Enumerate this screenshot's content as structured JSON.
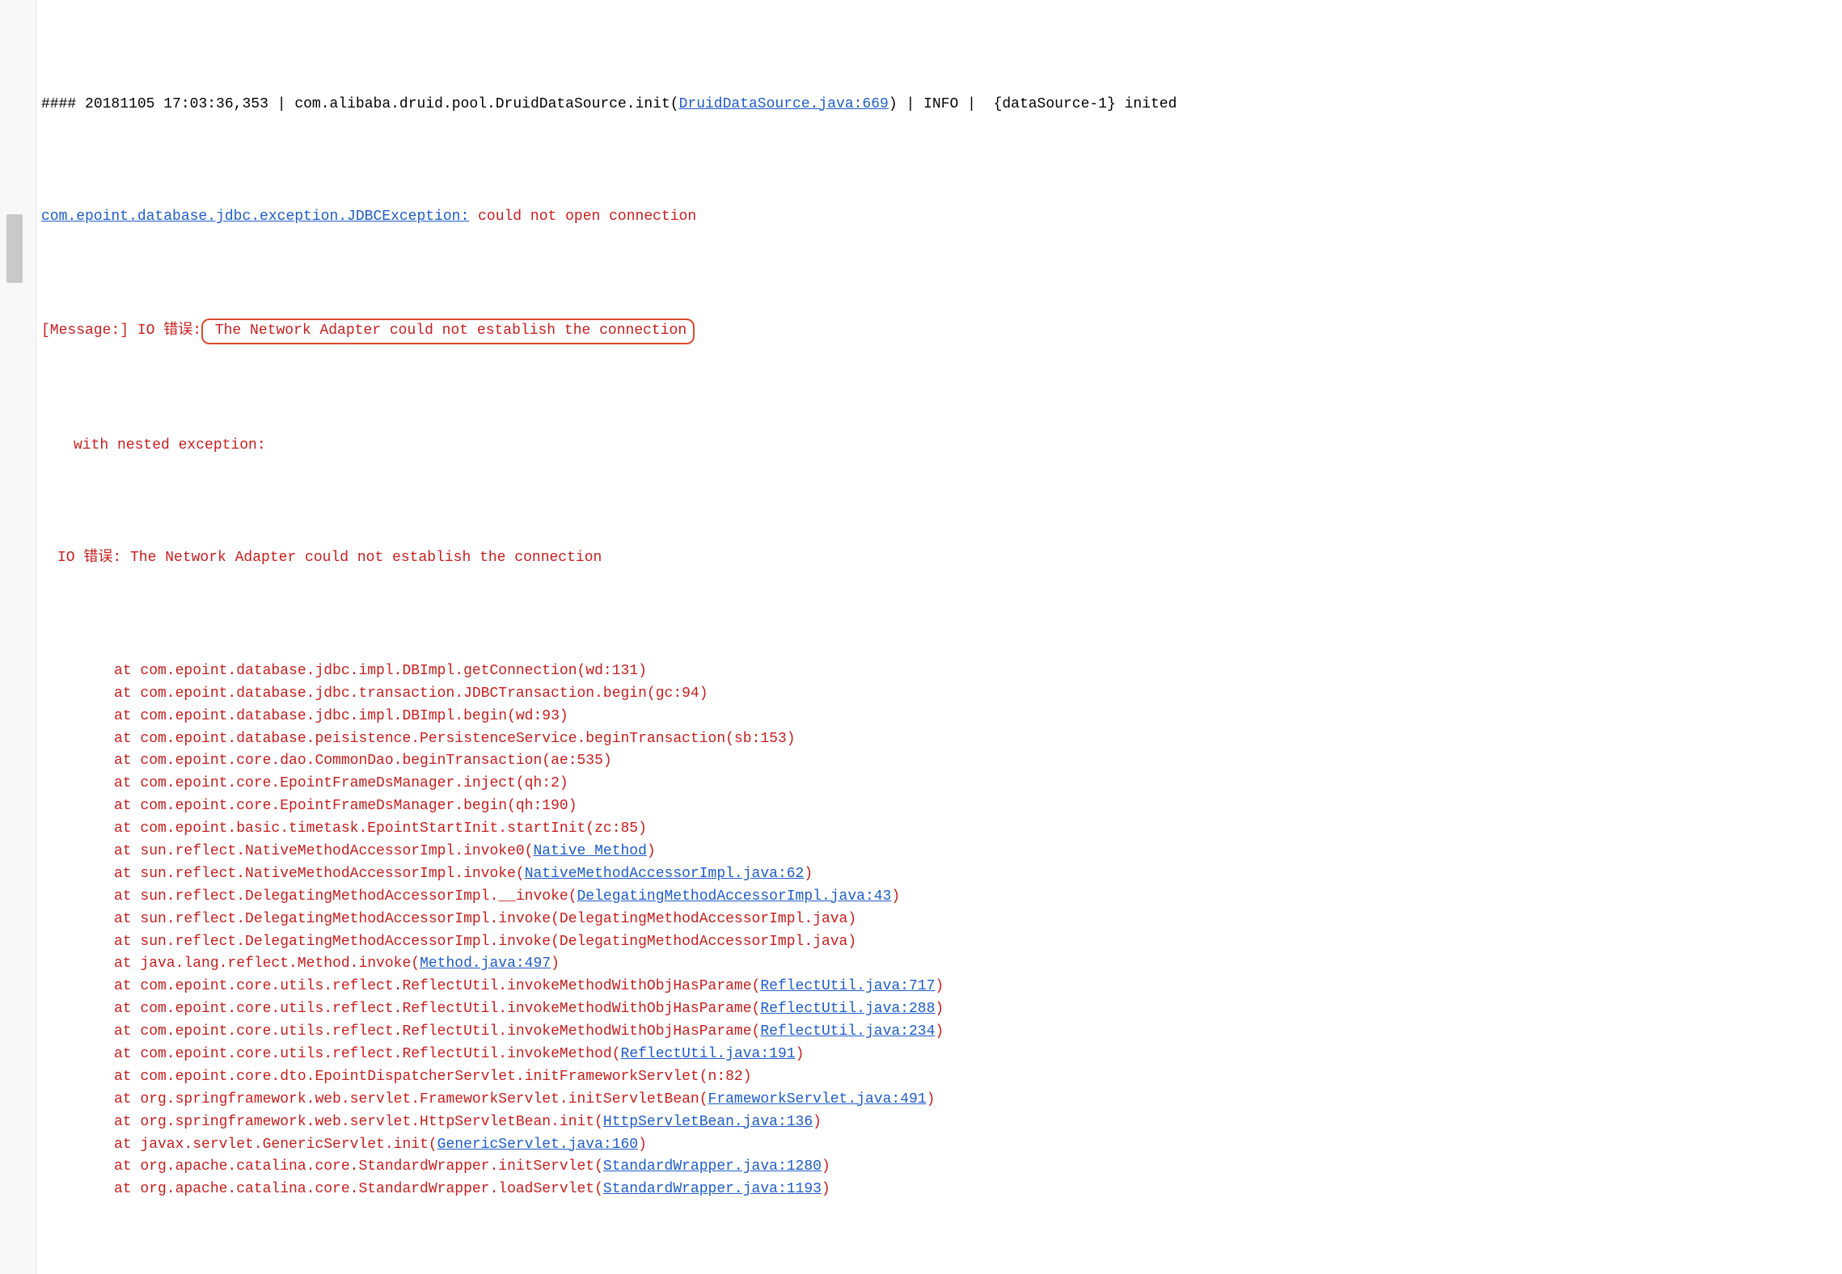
{
  "header": {
    "prefix": "####",
    "timestamp": "20181105 17:03:36,353",
    "sep1": "|",
    "class": "com.alibaba.druid.pool.DruidDataSource.init(",
    "source_link": "DruidDataSource.java:669",
    "close": ")",
    "sep2": "|",
    "level": "INFO",
    "sep3": "|",
    "msg": "{dataSource-1} inited"
  },
  "exc": {
    "class_link": "com.epoint.database.jdbc.exception.JDBCException:",
    "class_msg": " could not open connection",
    "msg_prefix": "[Message:] IO 错误:",
    "highlight": " The Network Adapter could not establish the connection",
    "nested": "with nested exception:",
    "io_line": "IO 错误: The Network Adapter could not establish the connection"
  },
  "stack": [
    {
      "pre": "at com.epoint.database.jdbc.impl.DBImpl.getConnection(wd:131)",
      "link": "",
      "post": ""
    },
    {
      "pre": "at com.epoint.database.jdbc.transaction.JDBCTransaction.begin(gc:94)",
      "link": "",
      "post": ""
    },
    {
      "pre": "at com.epoint.database.jdbc.impl.DBImpl.begin(wd:93)",
      "link": "",
      "post": ""
    },
    {
      "pre": "at com.epoint.database.peisistence.PersistenceService.beginTransaction(sb:153)",
      "link": "",
      "post": ""
    },
    {
      "pre": "at com.epoint.core.dao.CommonDao.beginTransaction(ae:535)",
      "link": "",
      "post": ""
    },
    {
      "pre": "at com.epoint.core.EpointFrameDsManager.inject(qh:2)",
      "link": "",
      "post": ""
    },
    {
      "pre": "at com.epoint.core.EpointFrameDsManager.begin(qh:190)",
      "link": "",
      "post": ""
    },
    {
      "pre": "at com.epoint.basic.timetask.EpointStartInit.startInit(zc:85)",
      "link": "",
      "post": ""
    },
    {
      "pre": "at sun.reflect.NativeMethodAccessorImpl.invoke0(",
      "link": "Native Method",
      "post": ")"
    },
    {
      "pre": "at sun.reflect.NativeMethodAccessorImpl.invoke(",
      "link": "NativeMethodAccessorImpl.java:62",
      "post": ")"
    },
    {
      "pre": "at sun.reflect.DelegatingMethodAccessorImpl.__invoke(",
      "link": "DelegatingMethodAccessorImpl.java:43",
      "post": ")"
    },
    {
      "pre": "at sun.reflect.DelegatingMethodAccessorImpl.invoke(DelegatingMethodAccessorImpl.java)",
      "link": "",
      "post": ""
    },
    {
      "pre": "at sun.reflect.DelegatingMethodAccessorImpl.invoke(DelegatingMethodAccessorImpl.java)",
      "link": "",
      "post": ""
    },
    {
      "pre": "at java.lang.reflect.Method.invoke(",
      "link": "Method.java:497",
      "post": ")"
    },
    {
      "pre": "at com.epoint.core.utils.reflect.ReflectUtil.invokeMethodWithObjHasParame(",
      "link": "ReflectUtil.java:717",
      "post": ")"
    },
    {
      "pre": "at com.epoint.core.utils.reflect.ReflectUtil.invokeMethodWithObjHasParame(",
      "link": "ReflectUtil.java:288",
      "post": ")"
    },
    {
      "pre": "at com.epoint.core.utils.reflect.ReflectUtil.invokeMethodWithObjHasParame(",
      "link": "ReflectUtil.java:234",
      "post": ")"
    },
    {
      "pre": "at com.epoint.core.utils.reflect.ReflectUtil.invokeMethod(",
      "link": "ReflectUtil.java:191",
      "post": ")"
    },
    {
      "pre": "at com.epoint.core.dto.EpointDispatcherServlet.initFrameworkServlet(n:82)",
      "link": "",
      "post": ""
    },
    {
      "pre": "at org.springframework.web.servlet.FrameworkServlet.initServletBean(",
      "link": "FrameworkServlet.java:491",
      "post": ")"
    },
    {
      "pre": "at org.springframework.web.servlet.HttpServletBean.init(",
      "link": "HttpServletBean.java:136",
      "post": ")"
    },
    {
      "pre": "at javax.servlet.GenericServlet.init(",
      "link": "GenericServlet.java:160",
      "post": ")"
    },
    {
      "pre": "at org.apache.catalina.core.StandardWrapper.initServlet(",
      "link": "StandardWrapper.java:1280",
      "post": ")"
    },
    {
      "pre": "at org.apache.catalina.core.StandardWrapper.loadServlet(",
      "link": "StandardWrapper.java:1193",
      "post": ")"
    }
  ]
}
